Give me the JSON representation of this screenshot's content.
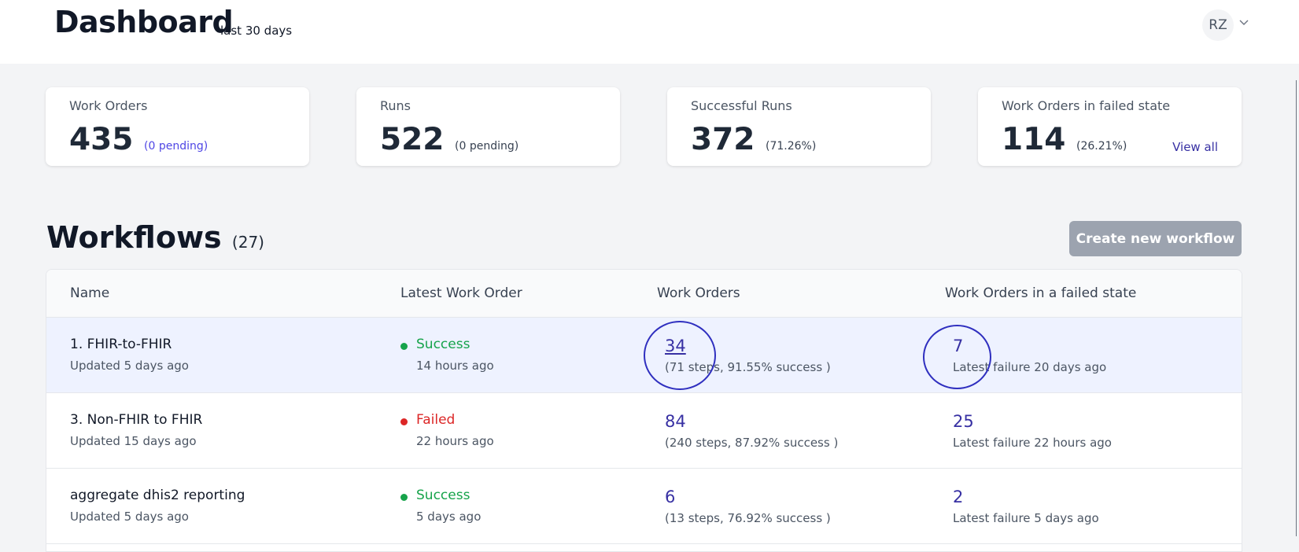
{
  "header": {
    "title": "Dashboard",
    "subtitle": "last 30 days",
    "avatar_initials": "RZ",
    "avatar_menu_icon": "chevron-down-icon"
  },
  "stats": [
    {
      "label": "Work Orders",
      "value": "435",
      "extra": "(0 pending)"
    },
    {
      "label": "Runs",
      "value": "522",
      "extra": "(0 pending)"
    },
    {
      "label": "Successful Runs",
      "value": "372",
      "extra": "(71.26%)"
    },
    {
      "label": "Work Orders in failed state",
      "value": "114",
      "extra": "(26.21%)",
      "link": "View all"
    }
  ],
  "workflows": {
    "title": "Workflows",
    "count": "(27)",
    "create_button": "Create new workflow",
    "columns": [
      "Name",
      "Latest Work Order",
      "Work Orders",
      "Work Orders in a failed state"
    ],
    "rows": [
      {
        "name": "1. FHIR-to-FHIR",
        "updated": "Updated 5 days ago",
        "status": "Success",
        "status_time": "14 hours ago",
        "work_orders": "34",
        "work_orders_detail": "(71 steps, 91.55% success )",
        "failed": "7",
        "failed_detail": "Latest failure 20 days ago"
      },
      {
        "name": "3. Non-FHIR to FHIR",
        "updated": "Updated 15 days ago",
        "status": "Failed",
        "status_time": "22 hours ago",
        "work_orders": "84",
        "work_orders_detail": "(240 steps, 87.92% success )",
        "failed": "25",
        "failed_detail": "Latest failure 22 hours ago"
      },
      {
        "name": "aggregate dhis2 reporting",
        "updated": "Updated 5 days ago",
        "status": "Success",
        "status_time": "5 days ago",
        "work_orders": "6",
        "work_orders_detail": "(13 steps, 76.92% success )",
        "failed": "2",
        "failed_detail": "Latest failure 5 days ago"
      }
    ]
  },
  "colors": {
    "success": "#16a34a",
    "failed": "#dc2626",
    "link": "#3730a3",
    "annotation": "#2f2fbf"
  }
}
